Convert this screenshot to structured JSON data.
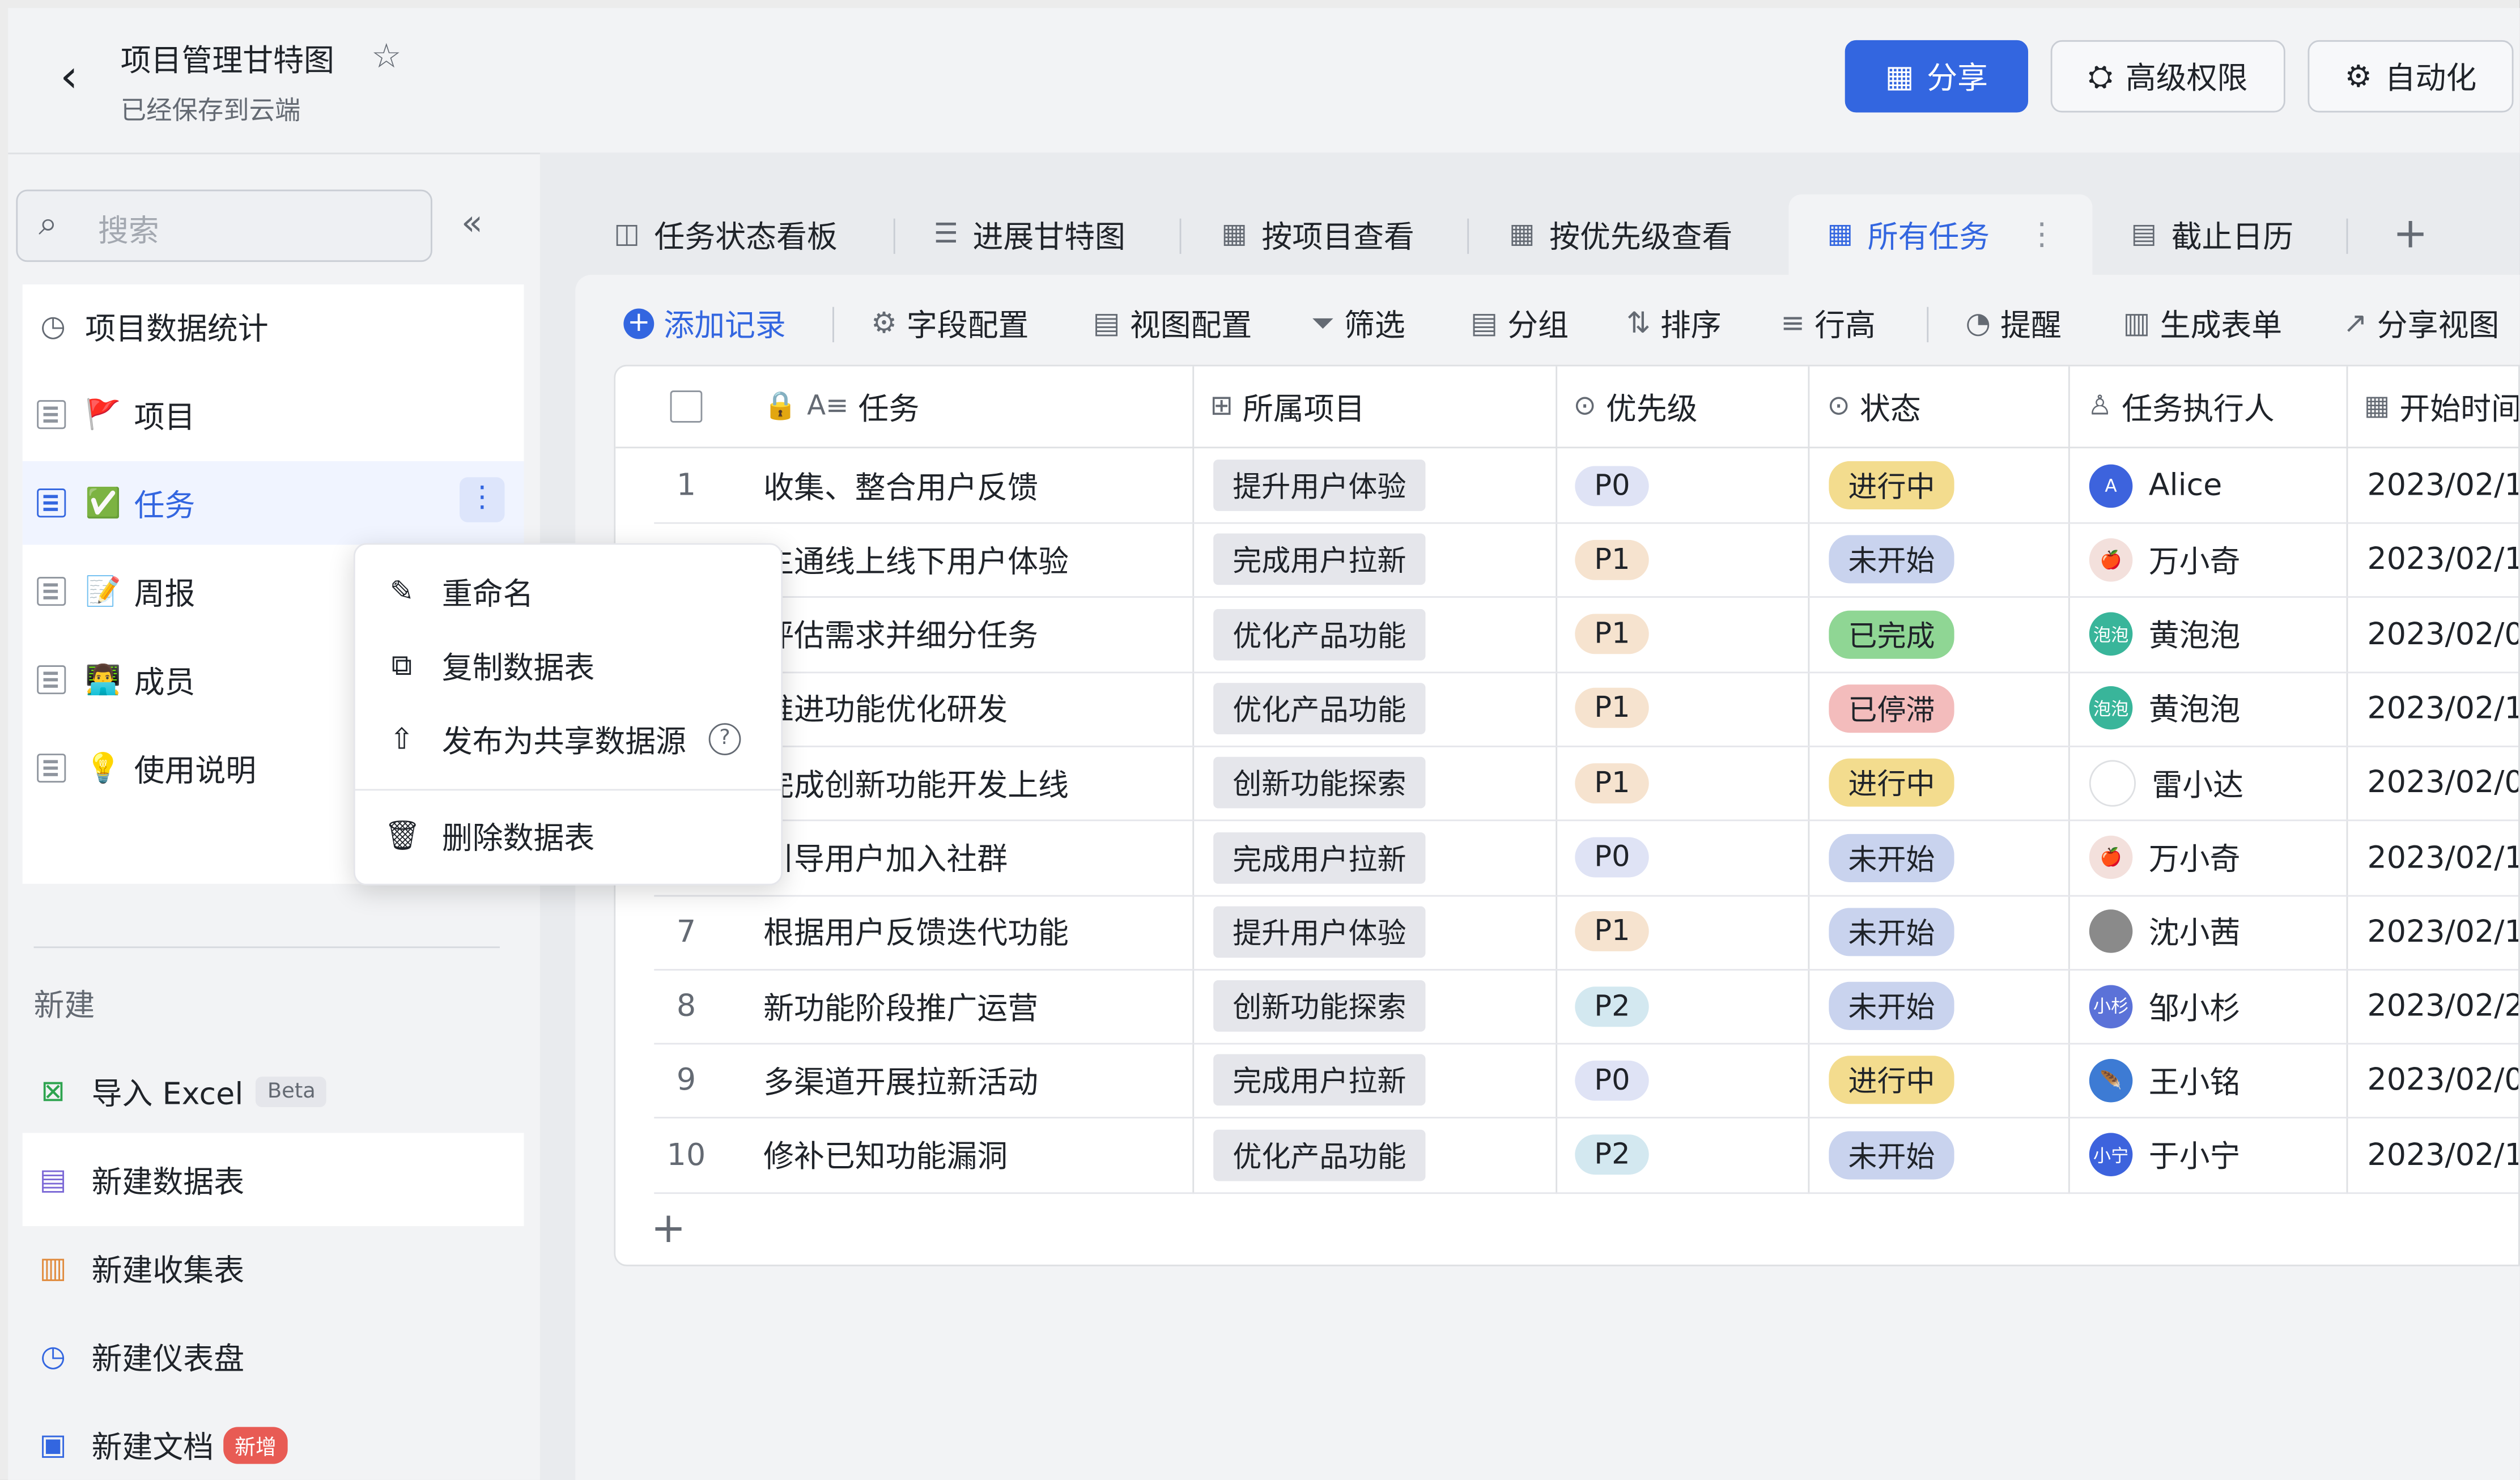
{
  "header": {
    "title": "项目管理甘特图",
    "subtitle": "已经保存到云端",
    "share": "分享",
    "permissions": "高级权限",
    "automation": "自动化"
  },
  "sidebar": {
    "search_placeholder": "搜索",
    "items": [
      {
        "label": "项目数据统计",
        "icon": "dashboard-icon",
        "emoji": ""
      },
      {
        "label": "项目",
        "icon": "table-icon",
        "emoji": "🚩"
      },
      {
        "label": "任务",
        "icon": "table-icon",
        "emoji": "✅"
      },
      {
        "label": "周报",
        "icon": "table-icon",
        "emoji": "📝"
      },
      {
        "label": "成员",
        "icon": "table-icon",
        "emoji": "👨‍💻"
      },
      {
        "label": "使用说明",
        "icon": "table-icon",
        "emoji": "💡"
      }
    ],
    "new_label": "新建",
    "new_items": [
      {
        "label": "导入 Excel",
        "badge": "Beta"
      },
      {
        "label": "新建数据表",
        "badge": ""
      },
      {
        "label": "新建收集表",
        "badge": ""
      },
      {
        "label": "新建仪表盘",
        "badge": ""
      },
      {
        "label": "新建文档",
        "badge": "新增"
      }
    ]
  },
  "context_menu": {
    "items": [
      "重命名",
      "复制数据表",
      "发布为共享数据源",
      "删除数据表"
    ],
    "help": "?"
  },
  "tabs": [
    "任务状态看板",
    "进展甘特图",
    "按项目查看",
    "按优先级查看",
    "所有任务",
    "截止日历"
  ],
  "toolbar": [
    "添加记录",
    "字段配置",
    "视图配置",
    "筛选",
    "分组",
    "排序",
    "行高",
    "提醒",
    "生成表单",
    "分享视图"
  ],
  "table": {
    "columns": [
      "任务",
      "所属项目",
      "优先级",
      "状态",
      "任务执行人",
      "开始时间"
    ],
    "rows": [
      {
        "n": "1",
        "task": "收集、整合用户反馈",
        "project": "提升用户体验",
        "priority": "P0",
        "status": "进行中",
        "assignee": "Alice",
        "avatar": "A",
        "start": "2023/02/1("
      },
      {
        "n": "",
        "task": "主通线上线下用户体验",
        "project": "完成用户拉新",
        "priority": "P1",
        "status": "未开始",
        "assignee": "万小奇",
        "avatar": "🍎",
        "start": "2023/02/1"
      },
      {
        "n": "",
        "task": "评估需求并细分任务",
        "project": "优化产品功能",
        "priority": "P1",
        "status": "已完成",
        "assignee": "黄泡泡",
        "avatar": "泡泡",
        "start": "2023/02/0"
      },
      {
        "n": "",
        "task": "推进功能优化研发",
        "project": "优化产品功能",
        "priority": "P1",
        "status": "已停滞",
        "assignee": "黄泡泡",
        "avatar": "泡泡",
        "start": "2023/02/1"
      },
      {
        "n": "",
        "task": "完成创新功能开发上线",
        "project": "创新功能探索",
        "priority": "P1",
        "status": "进行中",
        "assignee": "雷小达",
        "avatar": "",
        "start": "2023/02/0"
      },
      {
        "n": "",
        "task": "引导用户加入社群",
        "project": "完成用户拉新",
        "priority": "P0",
        "status": "未开始",
        "assignee": "万小奇",
        "avatar": "🍎",
        "start": "2023/02/1"
      },
      {
        "n": "7",
        "task": "根据用户反馈迭代功能",
        "project": "提升用户体验",
        "priority": "P1",
        "status": "未开始",
        "assignee": "沈小茜",
        "avatar": "",
        "start": "2023/02/1("
      },
      {
        "n": "8",
        "task": "新功能阶段推广运营",
        "project": "创新功能探索",
        "priority": "P2",
        "status": "未开始",
        "assignee": "邹小杉",
        "avatar": "小杉",
        "start": "2023/02/2"
      },
      {
        "n": "9",
        "task": "多渠道开展拉新活动",
        "project": "完成用户拉新",
        "priority": "P0",
        "status": "进行中",
        "assignee": "王小铭",
        "avatar": "🪶",
        "start": "2023/02/0"
      },
      {
        "n": "10",
        "task": "修补已知功能漏洞",
        "project": "优化产品功能",
        "priority": "P2",
        "status": "未开始",
        "assignee": "于小宁",
        "avatar": "小宁",
        "start": "2023/02/1"
      }
    ],
    "add_row": "+"
  },
  "colors": {
    "accent": "#3366e0",
    "priority": {
      "P0": "#dfe3f5",
      "P1": "#f6e3cf",
      "P2": "#d3e8f0"
    },
    "status": {
      "进行中": "#f3dc8e",
      "未开始": "#c9d3ee",
      "已完成": "#8fd694",
      "已停滞": "#f3bcbc"
    },
    "avatar_bg": [
      "#3d63dd",
      "#f3e0dc",
      "#39b59a",
      "#39b59a",
      "#ffffff",
      "#f3e0dc",
      "#8a8a8a",
      "#5b72d8",
      "#3d7bd4",
      "#3d63dd"
    ]
  }
}
